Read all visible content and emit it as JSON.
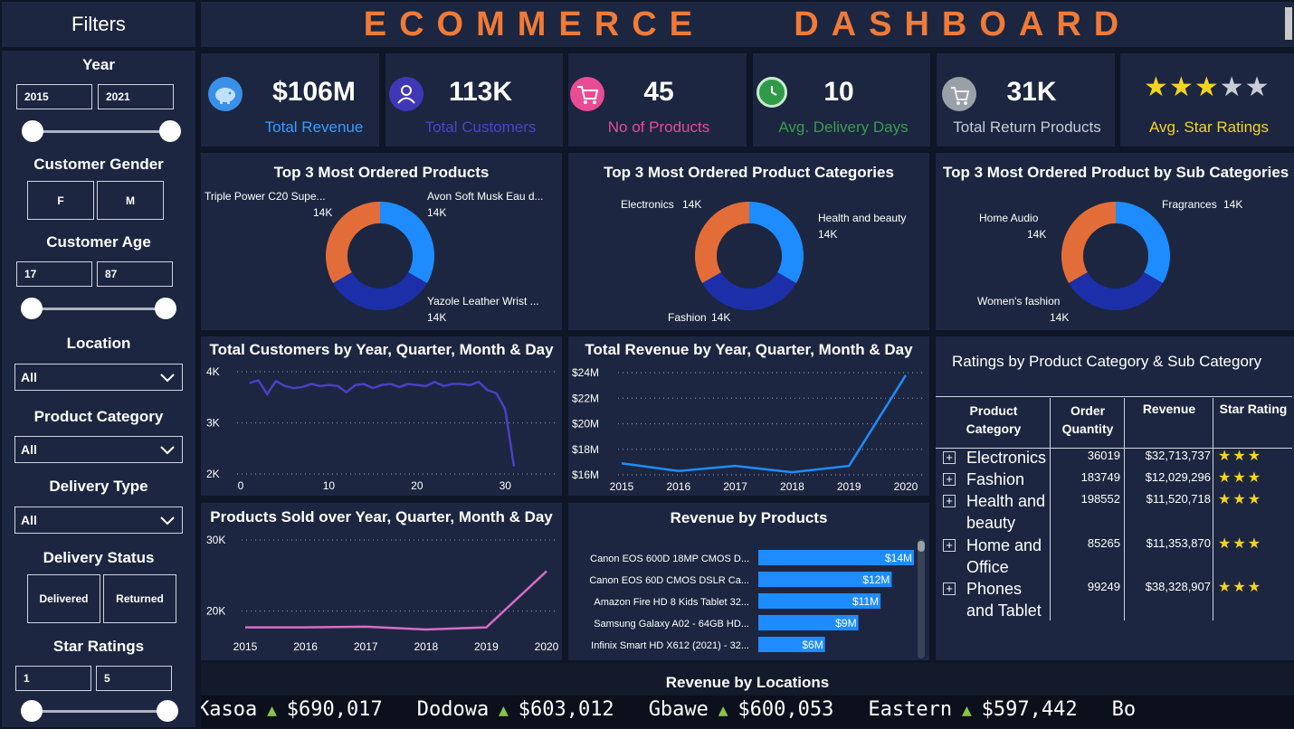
{
  "header": {
    "title": "ECOMMERCE    DASHBOARD"
  },
  "filters": {
    "title": "Filters",
    "year": {
      "label": "Year",
      "from": "2015",
      "to": "2021"
    },
    "gender": {
      "label": "Customer Gender",
      "options": [
        "F",
        "M"
      ]
    },
    "age": {
      "label": "Customer Age",
      "from": "17",
      "to": "87"
    },
    "location": {
      "label": "Location",
      "value": "All"
    },
    "product_category": {
      "label": "Product Category",
      "value": "All"
    },
    "delivery_type": {
      "label": "Delivery Type",
      "value": "All"
    },
    "delivery_status": {
      "label": "Delivery Status",
      "options": [
        "Delivered",
        "Returned"
      ]
    },
    "star_ratings": {
      "label": "Star Ratings",
      "from": "1",
      "to": "5"
    }
  },
  "kpis": [
    {
      "value": "$106M",
      "label": "Total Revenue",
      "color": "#3a9bff",
      "icon": "piggy-bank-icon"
    },
    {
      "value": "113K",
      "label": "Total Customers",
      "color": "#4b44c9",
      "icon": "user-icon"
    },
    {
      "value": "45",
      "label": "No of Products",
      "color": "#e84c94",
      "icon": "cart-icon"
    },
    {
      "value": "10",
      "label": "Avg. Delivery Days",
      "color": "#3c9a52",
      "icon": "clock-icon"
    },
    {
      "value": "31K",
      "label": "Total Return Products",
      "color": "#c8ccd4",
      "icon": "return-cart-icon"
    },
    {
      "value": "",
      "label": "Avg. Star Ratings",
      "color": "#f5d41f",
      "icon": "star-icon",
      "stars": 3,
      "max_stars": 5
    }
  ],
  "donuts": [
    {
      "title": "Top 3 Most Ordered Products",
      "chart_data": {
        "type": "pie",
        "slices": [
          {
            "label": "Avon Soft Musk Eau d...",
            "value_label": "14K",
            "value": 14000,
            "color": "#1e8cff"
          },
          {
            "label": "Yazole Leather Wrist ...",
            "value_label": "14K",
            "value": 14000,
            "color": "#1c2fa8"
          },
          {
            "label": "Triple Power C20 Supe...",
            "value_label": "14K",
            "value": 14000,
            "color": "#e36d38"
          }
        ]
      }
    },
    {
      "title": "Top 3 Most Ordered Product Categories",
      "chart_data": {
        "type": "pie",
        "slices": [
          {
            "label": "Health and beauty",
            "value_label": "14K",
            "value": 14000,
            "color": "#1e8cff"
          },
          {
            "label": "Fashion",
            "value_label": "14K",
            "value": 14000,
            "color": "#1c2fa8"
          },
          {
            "label": "Electronics",
            "value_label": "14K",
            "value": 14000,
            "color": "#e36d38"
          }
        ]
      }
    },
    {
      "title": "Top 3 Most Ordered Product by Sub Categories",
      "chart_data": {
        "type": "pie",
        "slices": [
          {
            "label": "Fragrances",
            "value_label": "14K",
            "value": 14000,
            "color": "#1e8cff"
          },
          {
            "label": "Women's fashion",
            "value_label": "14K",
            "value": 14000,
            "color": "#1c2fa8"
          },
          {
            "label": "Home Audio",
            "value_label": "14K",
            "value": 14000,
            "color": "#e36d38"
          }
        ]
      }
    }
  ],
  "customers_chart": {
    "title": "Total Customers by Year, Quarter, Month & Day",
    "chart_data": {
      "type": "line",
      "color": "#4b3fc4",
      "x": [
        1,
        2,
        3,
        4,
        5,
        6,
        7,
        8,
        9,
        10,
        11,
        12,
        13,
        14,
        15,
        16,
        17,
        18,
        19,
        20,
        21,
        22,
        23,
        24,
        25,
        26,
        27,
        28,
        29,
        30,
        31
      ],
      "y": [
        3780,
        3830,
        3560,
        3820,
        3720,
        3680,
        3700,
        3760,
        3720,
        3740,
        3720,
        3600,
        3740,
        3760,
        3680,
        3740,
        3760,
        3700,
        3760,
        3740,
        3720,
        3800,
        3720,
        3760,
        3760,
        3740,
        3800,
        3640,
        3580,
        3270,
        2150
      ],
      "xticks": [
        "0",
        "10",
        "20",
        "30"
      ],
      "xtick_values": [
        0,
        10,
        20,
        30
      ],
      "yticks": [
        "2K",
        "3K",
        "4K"
      ],
      "ytick_values": [
        2000,
        3000,
        4000
      ],
      "xlim": [
        0,
        31
      ],
      "ylim": [
        2000,
        4000
      ],
      "grid": true
    }
  },
  "revenue_chart": {
    "title": "Total Revenue by Year, Quarter, Month & Day",
    "chart_data": {
      "type": "line",
      "color": "#1e8cff",
      "x": [
        2015,
        2016,
        2017,
        2018,
        2019,
        2020
      ],
      "y": [
        16.9,
        16.3,
        16.7,
        16.2,
        16.7,
        23.8
      ],
      "xticks": [
        "2015",
        "2016",
        "2017",
        "2018",
        "2019",
        "2020"
      ],
      "xtick_values": [
        2015,
        2016,
        2017,
        2018,
        2019,
        2020
      ],
      "yticks": [
        "$16M",
        "$18M",
        "$20M",
        "$22M",
        "$24M"
      ],
      "ytick_values": [
        16,
        18,
        20,
        22,
        24
      ],
      "xlim": [
        2015,
        2020
      ],
      "ylim": [
        16,
        24
      ],
      "grid": true
    }
  },
  "products_sold_chart": {
    "title": "Products Sold over Year, Quarter, Month & Day",
    "chart_data": {
      "type": "line",
      "color": "#d86cc8",
      "x": [
        2015,
        2016,
        2017,
        2018,
        2019,
        2020
      ],
      "y": [
        17700,
        17700,
        17800,
        17400,
        17700,
        25600
      ],
      "xticks": [
        "2015",
        "2016",
        "2017",
        "2018",
        "2019",
        "2020"
      ],
      "xtick_values": [
        2015,
        2016,
        2017,
        2018,
        2019,
        2020
      ],
      "yticks": [
        "20K",
        "30K"
      ],
      "ytick_values": [
        20000,
        30000
      ],
      "xlim": [
        2015,
        2020
      ],
      "ylim": [
        16000,
        30000
      ],
      "grid": true
    }
  },
  "revenue_by_products": {
    "title": "Revenue by Products",
    "chart_data": {
      "type": "bar",
      "orientation": "horizontal",
      "color": "#1e8cff",
      "categories": [
        "Canon EOS 600D 18MP CMOS D...",
        "Canon EOS 60D CMOS DSLR Ca...",
        "Amazon Fire HD 8 Kids Tablet 32...",
        "Samsung Galaxy A02 - 64GB HD...",
        "Infinix Smart HD X612 (2021) - 32..."
      ],
      "values": [
        14,
        12,
        11,
        9,
        6
      ],
      "value_labels": [
        "$14M",
        "$12M",
        "$11M",
        "$9M",
        "$6M"
      ],
      "xlim": [
        0,
        14
      ]
    }
  },
  "ratings_table": {
    "title": "Ratings by Product Category & Sub Category",
    "headers": [
      "Product Category",
      "Order Quantity",
      "Revenue",
      "Star Rating"
    ],
    "rows": [
      {
        "category": "Electronics",
        "qty": "36019",
        "revenue": "$32,713,737",
        "stars": 3
      },
      {
        "category": "Fashion",
        "qty": "183749",
        "revenue": "$12,029,296",
        "stars": 3
      },
      {
        "category": "Health and beauty",
        "qty": "198552",
        "revenue": "$11,520,718",
        "stars": 3
      },
      {
        "category": "Home and Office",
        "qty": "85265",
        "revenue": "$11,353,870",
        "stars": 3
      },
      {
        "category": "Phones and Tablet",
        "qty": "99249",
        "revenue": "$38,328,907",
        "stars": 3
      }
    ]
  },
  "locations": {
    "title": "Revenue by Locations",
    "items": [
      {
        "name": "Kasoa",
        "value": "$690,017"
      },
      {
        "name": "Dodowa",
        "value": "$603,012"
      },
      {
        "name": "Gbawe",
        "value": "$600,053"
      },
      {
        "name": "Eastern",
        "value": "$597,442"
      },
      {
        "name": "Bo",
        "value": ""
      }
    ]
  }
}
